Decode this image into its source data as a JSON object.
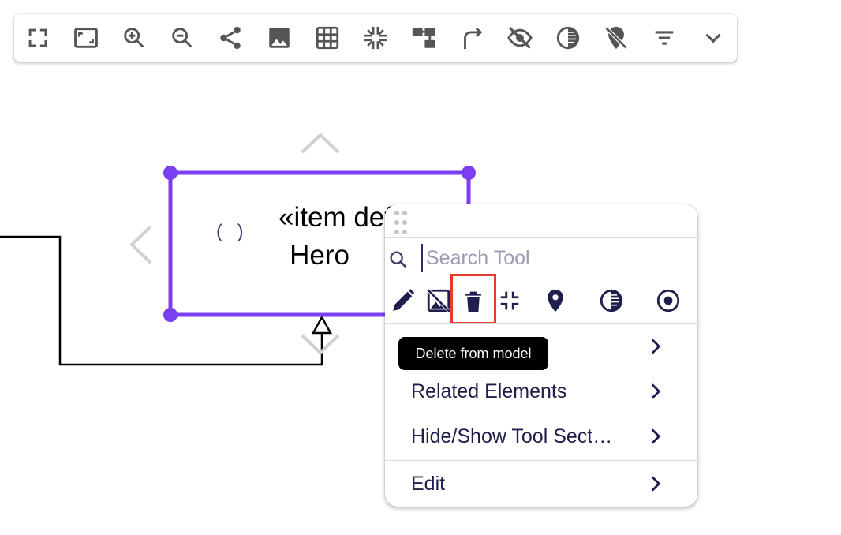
{
  "toolbar": {
    "buttons": [
      {
        "name": "fullscreen-icon",
        "tooltip": "Fullscreen"
      },
      {
        "name": "fit-to-screen-icon",
        "tooltip": "Fit to screen"
      },
      {
        "name": "zoom-in-icon",
        "tooltip": "Zoom in"
      },
      {
        "name": "zoom-out-icon",
        "tooltip": "Zoom out"
      },
      {
        "name": "share-icon",
        "tooltip": "Share"
      },
      {
        "name": "image-icon",
        "tooltip": "Export image"
      },
      {
        "name": "grid-icon",
        "tooltip": "Grid"
      },
      {
        "name": "snap-icon",
        "tooltip": "Snap"
      },
      {
        "name": "layout-icon",
        "tooltip": "Arrange"
      },
      {
        "name": "redo-arrow-icon",
        "tooltip": "Route"
      },
      {
        "name": "hide-icon",
        "tooltip": "Hide"
      },
      {
        "name": "contrast-icon",
        "tooltip": "Fade"
      },
      {
        "name": "unpin-icon",
        "tooltip": "Unpin"
      },
      {
        "name": "filter-icon",
        "tooltip": "Filter"
      },
      {
        "name": "chevron-down-icon",
        "tooltip": "More"
      }
    ]
  },
  "diagram": {
    "node": {
      "line1": "«item def",
      "line2": "Hero",
      "parens": "( )"
    }
  },
  "palette": {
    "search_placeholder": "Search Tool",
    "tools": [
      {
        "name": "pencil-icon"
      },
      {
        "name": "hide-image-icon"
      },
      {
        "name": "trash-icon"
      },
      {
        "name": "collapse-icon"
      },
      {
        "name": "pin-icon"
      },
      {
        "name": "contrast-icon"
      },
      {
        "name": "target-icon"
      }
    ],
    "menu": [
      {
        "label": ""
      },
      {
        "label": "Related Elements"
      },
      {
        "label": "Hide/Show Tool Sect…"
      },
      {
        "label": "Edit"
      }
    ],
    "tooltip": "Delete from model"
  },
  "colors": {
    "selection": "#7b3ff2",
    "icon": "#1f1f4d",
    "toolbar_icon": "#555555",
    "highlight": "#e53c2e"
  }
}
